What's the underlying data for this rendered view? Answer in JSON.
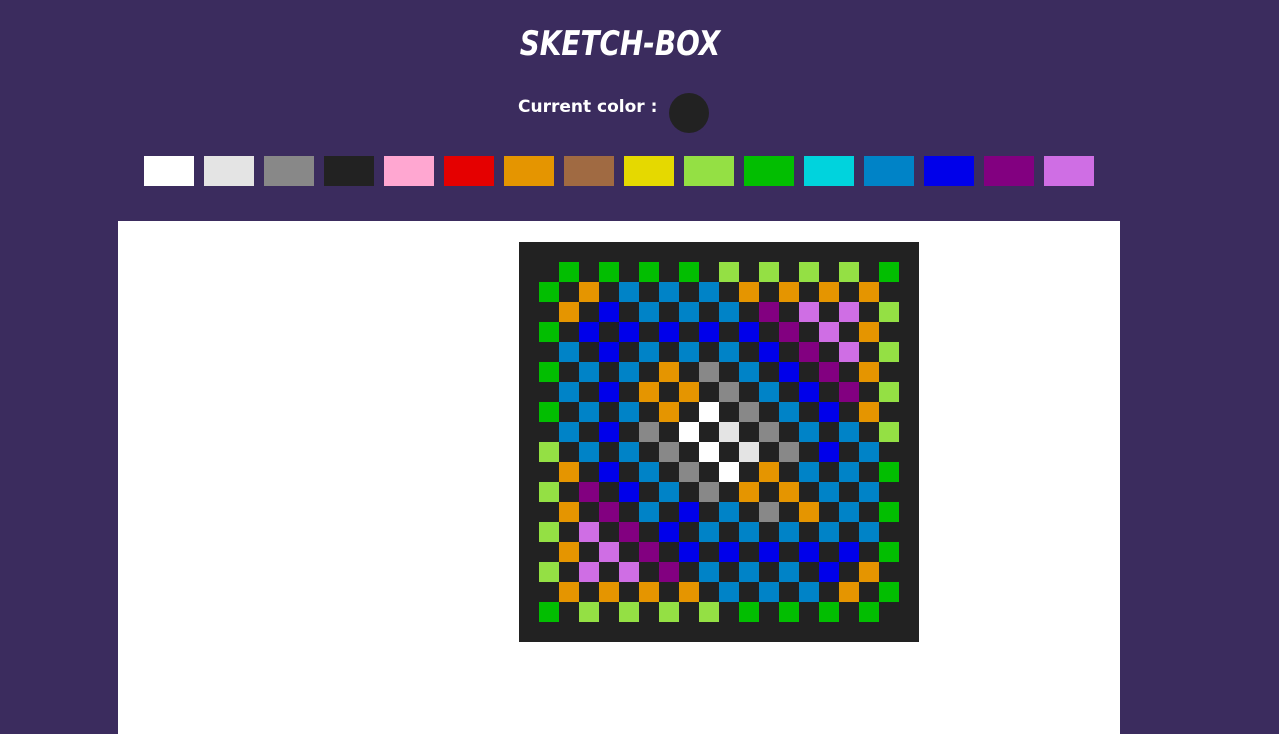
{
  "app": {
    "title": "SKETCH-BOX"
  },
  "current_color": {
    "label": "Current color :",
    "value": "#222222"
  },
  "palette": [
    {
      "name": "white",
      "color": "#ffffff"
    },
    {
      "name": "light-gray",
      "color": "#e4e4e4"
    },
    {
      "name": "gray",
      "color": "#888888"
    },
    {
      "name": "black",
      "color": "#222222"
    },
    {
      "name": "pink",
      "color": "#ffa7d1"
    },
    {
      "name": "red",
      "color": "#e50000"
    },
    {
      "name": "orange",
      "color": "#e59500"
    },
    {
      "name": "brown",
      "color": "#a06a42"
    },
    {
      "name": "yellow",
      "color": "#e5d900"
    },
    {
      "name": "light-green",
      "color": "#94e044"
    },
    {
      "name": "green",
      "color": "#02be01"
    },
    {
      "name": "cyan",
      "color": "#00d3dd"
    },
    {
      "name": "blue",
      "color": "#0083c7"
    },
    {
      "name": "dark-blue",
      "color": "#0000ea"
    },
    {
      "name": "purple",
      "color": "#820080"
    },
    {
      "name": "violet",
      "color": "#cf6ee4"
    }
  ],
  "grid": {
    "background": "#222222",
    "legend": {
      ".": "#222222",
      "g": "#02be01",
      "l": "#94e044",
      "o": "#e59500",
      "b": "#0083c7",
      "d": "#0000ea",
      "p": "#820080",
      "v": "#cf6ee4",
      "a": "#888888",
      "w": "#ffffff",
      "e": "#e4e4e4"
    },
    "rows": [
      "....................",
      "..g.g.g.g.l.l.l.l.g.",
      ".g.o.b.b.b.o.o.o.o..",
      "..o.d.b.b.b.p.v.v.l.",
      ".g.d.d.d.d.d.p.v.o..",
      "..b.d.b.b.b.d.p.v.l.",
      ".g.b.b.o.a.b.d.p.o..",
      "..b.d.o.o.a.b.d.p.l.",
      ".g.b.b.o.w.a.b.d.o..",
      "..b.d.a.w.e.a.b.b.l.",
      ".l.b.b.a.w.e.a.d.b..",
      "..o.d.b.a.w.o.b.b.g.",
      ".l.p.d.b.a.o.o.b.b..",
      "..o.p.b.d.b.a.o.b.g.",
      ".l.v.p.d.b.b.b.b.b..",
      "..o.v.p.d.d.d.d.d.g.",
      ".l.v.v.p.b.b.b.d.o..",
      "..o.o.o.o.b.b.b.o.g.",
      ".g.l.l.l.l.g.g.g.g..",
      "...................."
    ]
  }
}
